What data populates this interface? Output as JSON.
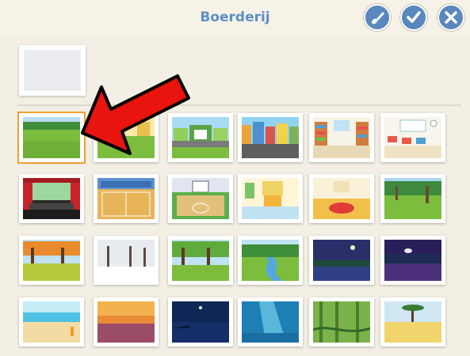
{
  "header": {
    "title": "Boerderij",
    "buttons": [
      {
        "name": "paint-button",
        "icon": "paintbrush-icon"
      },
      {
        "name": "confirm-button",
        "icon": "check-icon"
      },
      {
        "name": "close-button",
        "icon": "close-icon"
      }
    ]
  },
  "colors": {
    "accent": "#5a87bd",
    "title": "#5c8fc4",
    "background": "#f3efe4",
    "selection": "#f0a030",
    "arrow": "#e8140e"
  },
  "backgrounds": [
    {
      "name": "farm",
      "selected": true
    },
    {
      "name": "barn-field"
    },
    {
      "name": "suburb-street"
    },
    {
      "name": "city-street"
    },
    {
      "name": "library"
    },
    {
      "name": "classroom"
    },
    {
      "name": "theater-stage"
    },
    {
      "name": "gym-court"
    },
    {
      "name": "basketball-court"
    },
    {
      "name": "bedroom"
    },
    {
      "name": "living-room"
    },
    {
      "name": "park"
    },
    {
      "name": "autumn-forest"
    },
    {
      "name": "winter-forest"
    },
    {
      "name": "summer-forest"
    },
    {
      "name": "river-valley"
    },
    {
      "name": "night-lake"
    },
    {
      "name": "night-sky"
    },
    {
      "name": "beach"
    },
    {
      "name": "sunset-sea"
    },
    {
      "name": "night-harbor"
    },
    {
      "name": "underwater"
    },
    {
      "name": "jungle"
    },
    {
      "name": "savanna"
    }
  ]
}
